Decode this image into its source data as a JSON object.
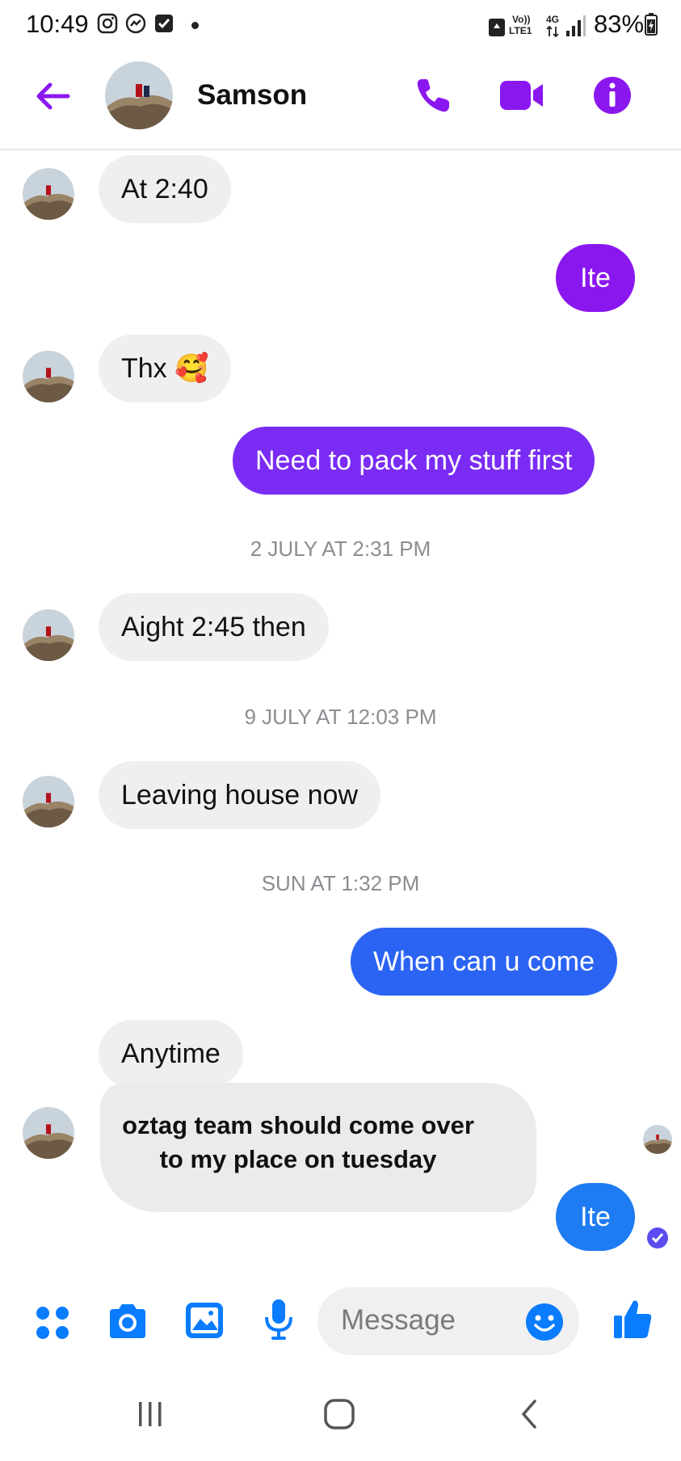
{
  "status_bar": {
    "time": "10:49",
    "volte": "Vo))",
    "lte": "LTE1",
    "net": "4G",
    "battery": "83%"
  },
  "header": {
    "title": "Samson"
  },
  "messages": {
    "m1": "At 2:40",
    "m2": "Ite",
    "m3": "Thx 🥰",
    "m4": "Need to pack my stuff first",
    "stamp1": "2 JULY AT 2:31 PM",
    "m5": "Aight 2:45 then",
    "stamp2": "9 JULY AT 12:03 PM",
    "m6": "Leaving house now",
    "stamp3": "SUN AT 1:32 PM",
    "m7": "When can u come",
    "m8": "Anytime",
    "m9_line1": "oztag team should come over",
    "m9_line2": "to my place on tuesday",
    "m10": "Ite"
  },
  "composer": {
    "placeholder": "Message"
  },
  "colors": {
    "accent": "#8b17ef",
    "blue": "#2b63f3",
    "composer_blue": "#0a7cff"
  }
}
